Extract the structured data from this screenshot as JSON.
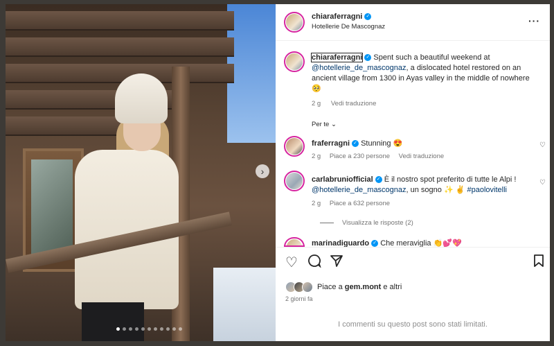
{
  "post": {
    "author": "chiaraferragni",
    "location": "Hotellerie De Mascognaz",
    "more_icon": "more-horizontal-icon",
    "photo_dots_count": 11,
    "caption": {
      "author": "chiaraferragni",
      "text_before": " Spent such a beautiful weekend at ",
      "mention": "@hotellerie_de_mascognaz",
      "text_after": ", a dislocated hotel restored on an ancient village from 1300 in Ayas valley in the middle of nowhere 🥺",
      "time": "2 g",
      "translate": "Vedi traduzione"
    },
    "for_you": "Per te",
    "comments": [
      {
        "author": "fraferragni",
        "text": "Stunning 😍",
        "time": "2 g",
        "likes": "Piace a 230 persone",
        "translate": "Vedi traduzione"
      },
      {
        "author": "carlabrunіofficial",
        "text_before": " È il nostro spot preferito di tutte le Alpi !",
        "mention": "@hotellerie_de_mascognaz",
        "text_mid": ", un sogno ✨ ✌️ ",
        "hashtag": "#paolovitelli",
        "time": "2 g",
        "likes": "Piace a 632 persone"
      },
      {
        "author": "marinadiguardo",
        "text": "Che meraviglia 👏💕💖"
      }
    ],
    "view_replies": "Visualizza le risposte (2)",
    "likes_prefix": "Piace a ",
    "likes_user": "gem.mont",
    "likes_suffix": " e altri",
    "date": "2 giorni fa",
    "comments_disabled": "I commenti su questo post sono stati limitati."
  },
  "icons": {
    "like": "heart-icon",
    "comment": "comment-icon",
    "share": "send-icon",
    "save": "bookmark-icon",
    "next": "chevron-right-icon"
  }
}
